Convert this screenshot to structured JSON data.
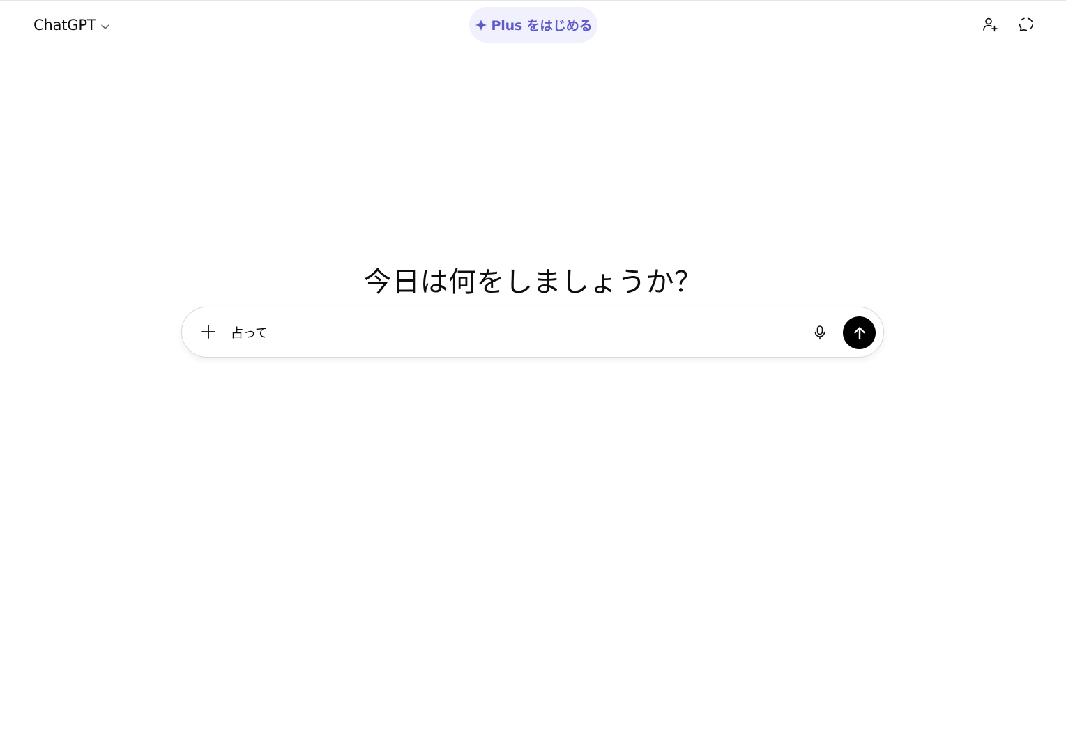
{
  "header": {
    "model_name": "ChatGPT",
    "upgrade_label": "Plus をはじめる",
    "accent_color": "#5e5ac9",
    "pill_background": "#f1f0fd",
    "icons": {
      "model_dropdown": "chevron-down-icon",
      "upgrade": "sparkle-icon",
      "add_user": "add-user-icon",
      "temporary_chat": "temporary-chat-icon"
    }
  },
  "main": {
    "heading": "今日は何をしましょうか？"
  },
  "composer": {
    "value": "占って",
    "icons": {
      "attach": "plus-icon",
      "voice": "microphone-icon",
      "send": "arrow-up-icon"
    }
  }
}
